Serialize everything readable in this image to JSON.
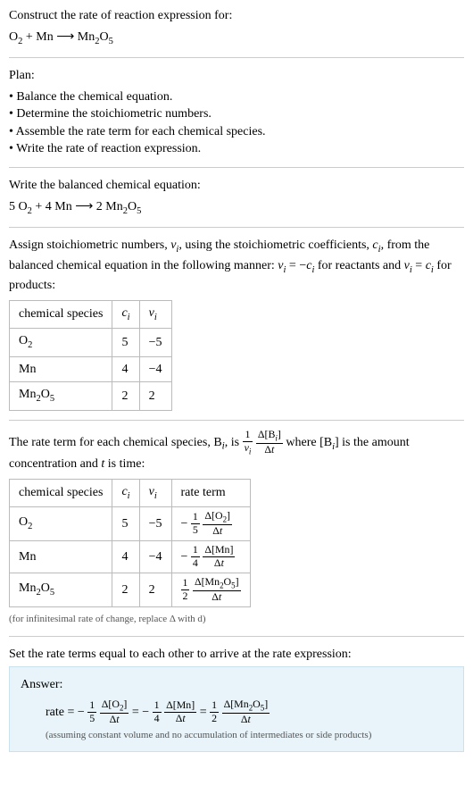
{
  "prompt": {
    "line1": "Construct the rate of reaction expression for:",
    "equation_html": "O<sub>2</sub> + Mn ⟶ Mn<sub>2</sub>O<sub>5</sub>"
  },
  "plan": {
    "title": "Plan:",
    "items": [
      "Balance the chemical equation.",
      "Determine the stoichiometric numbers.",
      "Assemble the rate term for each chemical species.",
      "Write the rate of reaction expression."
    ]
  },
  "balanced": {
    "title": "Write the balanced chemical equation:",
    "equation_html": "5 O<sub>2</sub> + 4 Mn ⟶ 2 Mn<sub>2</sub>O<sub>5</sub>"
  },
  "stoich": {
    "intro_html": "Assign stoichiometric numbers, <i>ν<sub>i</sub></i>, using the stoichiometric coefficients, <i>c<sub>i</sub></i>, from the balanced chemical equation in the following manner: <i>ν<sub>i</sub></i> = −<i>c<sub>i</sub></i> for reactants and <i>ν<sub>i</sub></i> = <i>c<sub>i</sub></i> for products:",
    "headers": {
      "species": "chemical species",
      "c": "c",
      "nu": "ν"
    },
    "rows": [
      {
        "species_html": "O<sub>2</sub>",
        "c": "5",
        "nu": "−5"
      },
      {
        "species_html": "Mn",
        "c": "4",
        "nu": "−4"
      },
      {
        "species_html": "Mn<sub>2</sub>O<sub>5</sub>",
        "c": "2",
        "nu": "2"
      }
    ]
  },
  "rate_terms": {
    "intro_pre": "The rate term for each chemical species, B",
    "intro_mid": ", is",
    "intro_post_html": "where [B<sub><i>i</i></sub>] is the amount concentration and <i>t</i> is time:",
    "frac1_num": "1",
    "frac1_den_html": "<i>ν<sub>i</sub></i>",
    "frac2_num_html": "Δ[B<sub><i>i</i></sub>]",
    "frac2_den_html": "Δ<i>t</i>",
    "headers": {
      "species": "chemical species",
      "c": "c",
      "nu": "ν",
      "rate": "rate term"
    },
    "rows": [
      {
        "species_html": "O<sub>2</sub>",
        "c": "5",
        "nu": "−5",
        "sign": "−",
        "f1num": "1",
        "f1den": "5",
        "f2num_html": "Δ[O<sub>2</sub>]",
        "f2den_html": "Δ<i>t</i>"
      },
      {
        "species_html": "Mn",
        "c": "4",
        "nu": "−4",
        "sign": "−",
        "f1num": "1",
        "f1den": "4",
        "f2num_html": "Δ[Mn]",
        "f2den_html": "Δ<i>t</i>"
      },
      {
        "species_html": "Mn<sub>2</sub>O<sub>5</sub>",
        "c": "2",
        "nu": "2",
        "sign": "",
        "f1num": "1",
        "f1den": "2",
        "f2num_html": "Δ[Mn<sub>2</sub>O<sub>5</sub>]",
        "f2den_html": "Δ<i>t</i>"
      }
    ],
    "note": "(for infinitesimal rate of change, replace Δ with d)"
  },
  "final": {
    "intro": "Set the rate terms equal to each other to arrive at the rate expression:"
  },
  "answer": {
    "label": "Answer:",
    "rate_label": "rate = ",
    "note": "(assuming constant volume and no accumulation of intermediates or side products)",
    "terms": [
      {
        "sign": "−",
        "f1num": "1",
        "f1den": "5",
        "f2num_html": "Δ[O<sub>2</sub>]",
        "f2den_html": "Δ<i>t</i>"
      },
      {
        "sign": "−",
        "f1num": "1",
        "f1den": "4",
        "f2num_html": "Δ[Mn]",
        "f2den_html": "Δ<i>t</i>"
      },
      {
        "sign": "",
        "f1num": "1",
        "f1den": "2",
        "f2num_html": "Δ[Mn<sub>2</sub>O<sub>5</sub>]",
        "f2den_html": "Δ<i>t</i>"
      }
    ]
  }
}
